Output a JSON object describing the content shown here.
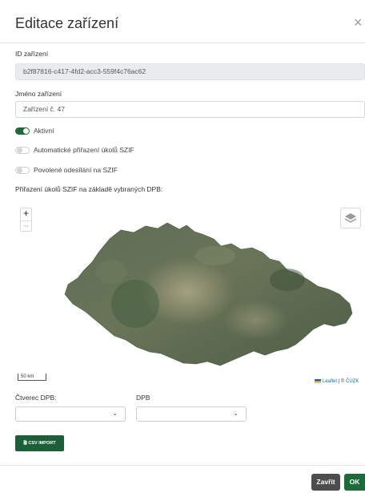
{
  "dialog": {
    "title": "Editace zařízení",
    "close_icon": "×"
  },
  "device_id": {
    "label": "ID zařízení",
    "value": "b2f87816-c417-4fd2-acc3-559f4c76ac62"
  },
  "device_name": {
    "label": "Jméno zařízení",
    "value": "Zařízení č. 47"
  },
  "toggles": [
    {
      "label": "Aktivní",
      "on": true
    },
    {
      "label": "Automatické přiřazení úkolů SZIF",
      "on": false
    },
    {
      "label": "Povolené odesílání na SZIF",
      "on": false
    }
  ],
  "map": {
    "label": "Přiřazení úkolů SZIF na základě vybraných DPB:",
    "zoom_in": "+",
    "zoom_out": "−",
    "scale": "50 km",
    "attribution_leaflet": "Leaflet",
    "attribution_sep": " | © ",
    "attribution_source": "ČÚZK",
    "layers_icon": "layers-icon"
  },
  "filters": {
    "ctverec_label": "Čtverec DPB:",
    "dpb_label": "DPB",
    "ctverec_value": "",
    "dpb_value": ""
  },
  "csv_button": "CSV IMPORT",
  "footer": {
    "close_label": "Zavřít",
    "ok_label": "OK"
  },
  "colors": {
    "accent": "#1e6a3b",
    "secondary_button": "#4d4d4d"
  }
}
